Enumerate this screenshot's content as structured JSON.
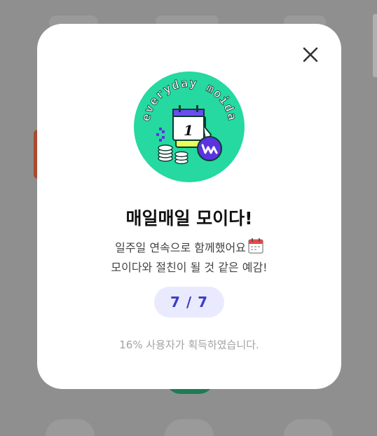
{
  "modal": {
    "badge_text": "everyday moida",
    "calendar_day": "1",
    "title": "매일매일 모이다!",
    "description_line1": "일주일 연속으로 함께했어요",
    "description_line2": "모이다와 절친이 될 것 같은 예감!",
    "progress_text": "7 / 7",
    "stat_text": "16% 사용자가 획득하였습니다."
  },
  "icons": [
    "close-icon",
    "calendar-emoji-icon",
    "badge-calendar-icon",
    "coin-stack-icon",
    "moida-logo-icon"
  ],
  "colors": {
    "badge_bg": "#25d9a0",
    "progress_bg": "#eaeaff",
    "progress_text": "#3a3fc2",
    "logo_purple": "#5a34e0"
  }
}
